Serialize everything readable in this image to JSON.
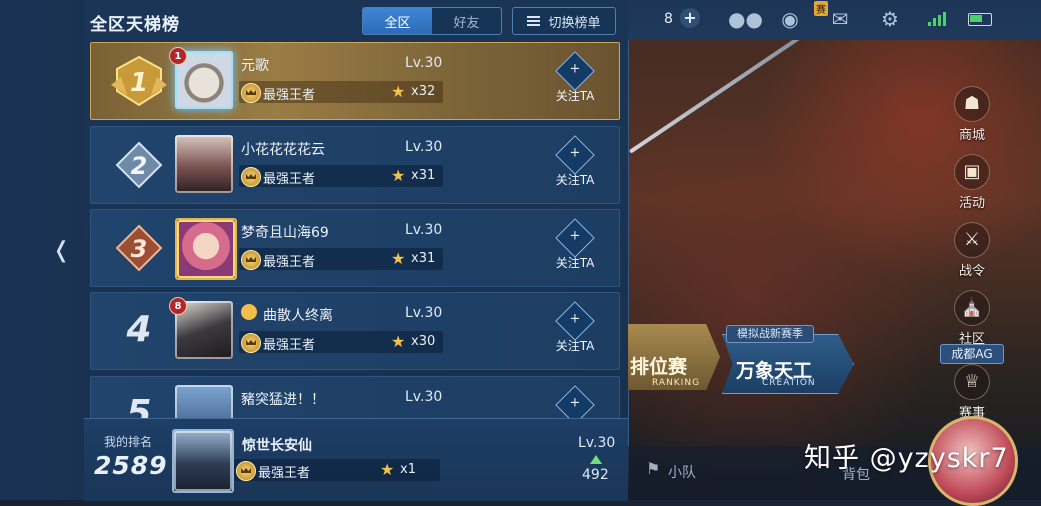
{
  "panel": {
    "title": "全区天梯榜",
    "tabs": [
      {
        "label": "全区",
        "active": true
      },
      {
        "label": "好友",
        "active": false
      }
    ],
    "switch_label": "切换榜单"
  },
  "rows": [
    {
      "rank": "1",
      "level_badge": "1",
      "name": "元歌",
      "lv": "Lv.30",
      "title": "最强王者",
      "stars": "x32",
      "follow": "关注TA"
    },
    {
      "rank": "2",
      "level_badge": "",
      "name": "小花花花花云",
      "lv": "Lv.30",
      "title": "最强王者",
      "stars": "x31",
      "follow": "关注TA"
    },
    {
      "rank": "3",
      "level_badge": "",
      "name": "梦奇且山海69",
      "lv": "Lv.30",
      "title": "最强王者",
      "stars": "x31",
      "follow": "关注TA"
    },
    {
      "rank": "4",
      "level_badge": "8",
      "name": "曲散人终离",
      "lv": "Lv.30",
      "title": "最强王者",
      "stars": "x30",
      "follow": "关注TA"
    },
    {
      "rank": "5",
      "level_badge": "",
      "name": "豬突猛进！！",
      "lv": "Lv.30",
      "title": "",
      "stars": "",
      "follow": ""
    }
  ],
  "mine": {
    "label": "我的排名",
    "rank": "2589",
    "name": "惊世长安仙",
    "lv": "Lv.30",
    "title": "最强王者",
    "stars": "x1",
    "points": "492"
  },
  "status": {
    "coins": "8",
    "new_tag": "赛"
  },
  "right_menu": [
    {
      "label": "商城",
      "icon": "shop-icon"
    },
    {
      "label": "活动",
      "icon": "activity-icon"
    },
    {
      "label": "战令",
      "icon": "battle-pass-icon"
    },
    {
      "label": "社区",
      "icon": "community-icon"
    },
    {
      "label": "赛事",
      "icon": "trophy-icon"
    }
  ],
  "guild_tag": "成都AG",
  "banners": {
    "rank_text": "排位赛",
    "rank_sub": "RANKING",
    "sim_tag": "模拟战新赛季",
    "sim_text": "万象天工",
    "sim_sub": "CREATION"
  },
  "bottom": {
    "team": "小队",
    "bag": "背包"
  },
  "watermark": "知乎 @yzyskr7",
  "colors": {
    "gold_row": "#9a7c45",
    "panel": "#1b3556",
    "accent": "#3f86d6",
    "up_arrow": "#6fe07a"
  }
}
